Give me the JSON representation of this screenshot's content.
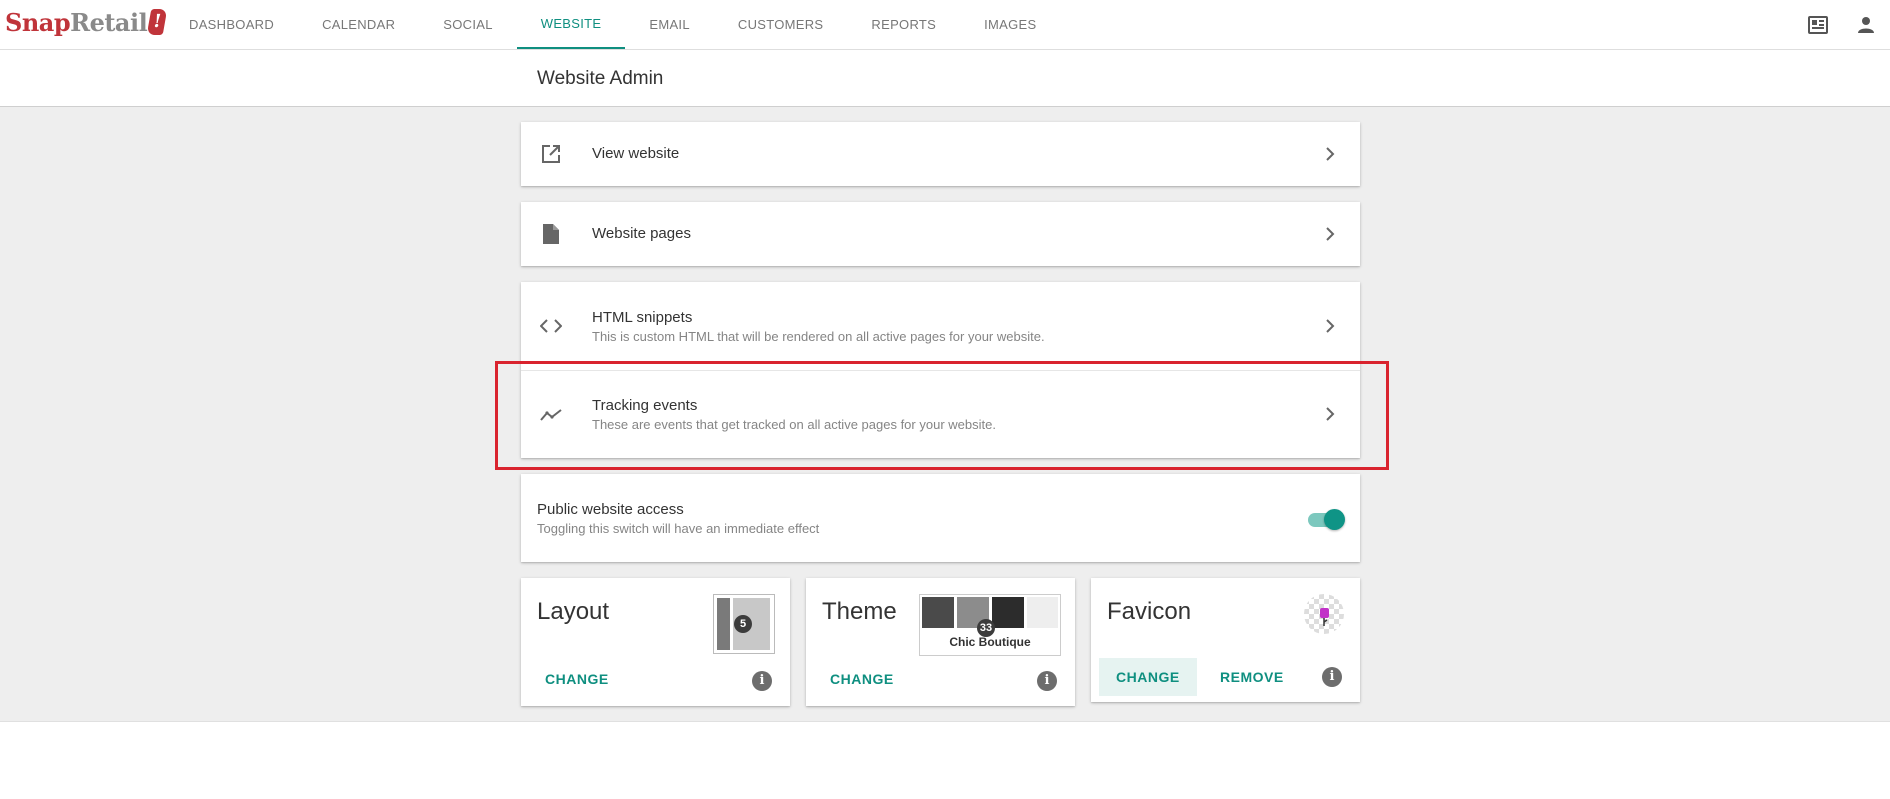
{
  "brand": {
    "name_part1": "Snap",
    "name_part2": "Retail",
    "mark": "!"
  },
  "nav": {
    "items": [
      {
        "label": "DASHBOARD",
        "active": false
      },
      {
        "label": "CALENDAR",
        "active": false
      },
      {
        "label": "SOCIAL",
        "active": false
      },
      {
        "label": "WEBSITE",
        "active": true
      },
      {
        "label": "EMAIL",
        "active": false
      },
      {
        "label": "CUSTOMERS",
        "active": false
      },
      {
        "label": "REPORTS",
        "active": false
      },
      {
        "label": "IMAGES",
        "active": false
      }
    ],
    "right_icons": [
      "store-directory-icon",
      "account-icon"
    ]
  },
  "page": {
    "title": "Website Admin"
  },
  "rows": {
    "view_website": {
      "title": "View website",
      "icon": "open-in-new-icon"
    },
    "website_pages": {
      "title": "Website pages",
      "icon": "document-icon"
    },
    "html_snippets": {
      "title": "HTML snippets",
      "subtitle": "This is custom HTML that will be rendered on all active pages for your website.",
      "icon": "code-icon"
    },
    "tracking_events": {
      "title": "Tracking events",
      "subtitle": "These are events that get tracked on all active pages for your website.",
      "icon": "trending-icon"
    }
  },
  "public_access": {
    "title": "Public website access",
    "subtitle": "Toggling this switch will have an immediate effect",
    "enabled": true
  },
  "layout_card": {
    "title": "Layout",
    "badge": "5",
    "change_label": "CHANGE"
  },
  "theme_card": {
    "title": "Theme",
    "badge": "33",
    "theme_name": "Chic Boutique",
    "change_label": "CHANGE"
  },
  "favicon_card": {
    "title": "Favicon",
    "change_label": "CHANGE",
    "remove_label": "REMOVE"
  },
  "colors": {
    "accent": "#0f8f80",
    "brand_red": "#c0343a",
    "highlight": "#d9232e"
  }
}
